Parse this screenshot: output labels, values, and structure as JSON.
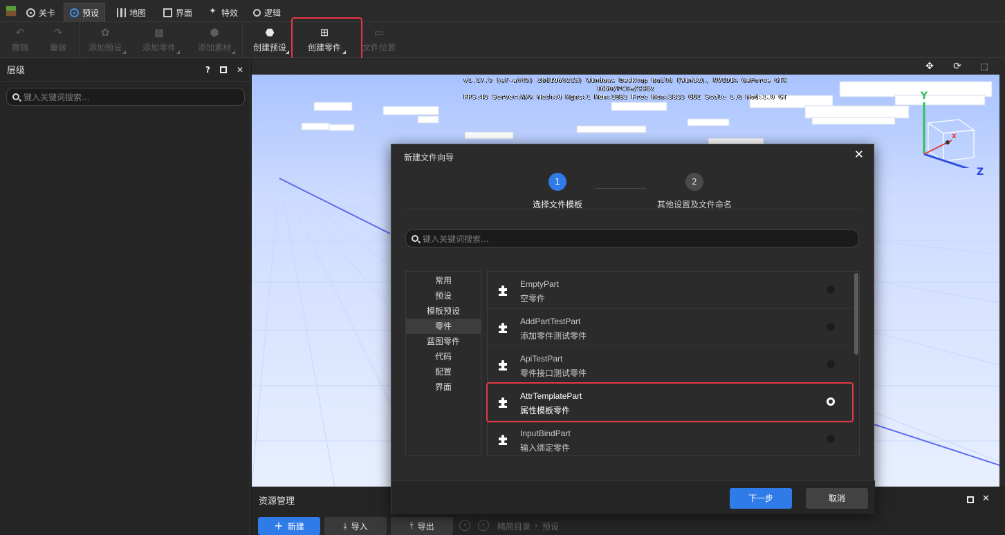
{
  "tabs": [
    {
      "label": "关卡",
      "icon": "target-icon"
    },
    {
      "label": "预设",
      "icon": "target-icon",
      "active": true
    },
    {
      "label": "地图",
      "icon": "map-icon"
    },
    {
      "label": "界面",
      "icon": "window-icon"
    },
    {
      "label": "特效",
      "icon": "sparkle-icon"
    },
    {
      "label": "逻辑",
      "icon": "logic-icon"
    }
  ],
  "toolbar": {
    "undo": "撤销",
    "redo": "重做",
    "add_preset": "添加预设",
    "add_part": "添加零件",
    "add_material": "添加素材",
    "create_preset": "创建预设",
    "create_part": "创建零件",
    "file_location": "文件位置"
  },
  "hierarchy": {
    "title": "层级",
    "help": "?",
    "close": "✕",
    "search_placeholder": "键入关键词搜索..."
  },
  "viewport": {
    "debug_line1": "v1.17.9 (af-a449) 28d1964215) Windows Desktop Build (Win32), NVIDIA GeForce GTX 1650/PCIe/SSE2",
    "debug_line2": "FPS:49 Server:N/A Mesh:0 Mgms:1 Mem:1083 Free Mem:3833 GUI Scale 1.0 Mod:1.0 GT",
    "gizmo_y": "Y",
    "gizmo_z": "Z",
    "gizmo_x": "X"
  },
  "dialog": {
    "title": "新建文件向导",
    "close": "✕",
    "steps": [
      {
        "number": "1",
        "label": "选择文件模板",
        "active": true
      },
      {
        "number": "2",
        "label": "其他设置及文件命名",
        "active": false
      }
    ],
    "search_placeholder": "键入关键词搜索...",
    "categories": [
      "常用",
      "预设",
      "模板预设",
      "零件",
      "蓝图零件",
      "代码",
      "配置",
      "界面"
    ],
    "active_category": "零件",
    "templates": [
      {
        "name": "EmptyPart",
        "desc": "空零件",
        "selected": false
      },
      {
        "name": "AddPartTestPart",
        "desc": "添加零件测试零件",
        "selected": false
      },
      {
        "name": "ApiTestPart",
        "desc": "零件接口测试零件",
        "selected": false
      },
      {
        "name": "AttrTemplatePart",
        "desc": "属性模板零件",
        "selected": true
      },
      {
        "name": "InputBindPart",
        "desc": "输入绑定零件",
        "selected": false
      }
    ],
    "next": "下一步",
    "cancel": "取消"
  },
  "assets": {
    "title": "资源管理",
    "new": "新建",
    "import": "导入",
    "export": "导出",
    "crumb_root": "精简目录",
    "crumb_current": "预设"
  },
  "colors": {
    "accent": "#2f7be8",
    "highlight": "#e53842",
    "sky": "#d7e3ff"
  }
}
